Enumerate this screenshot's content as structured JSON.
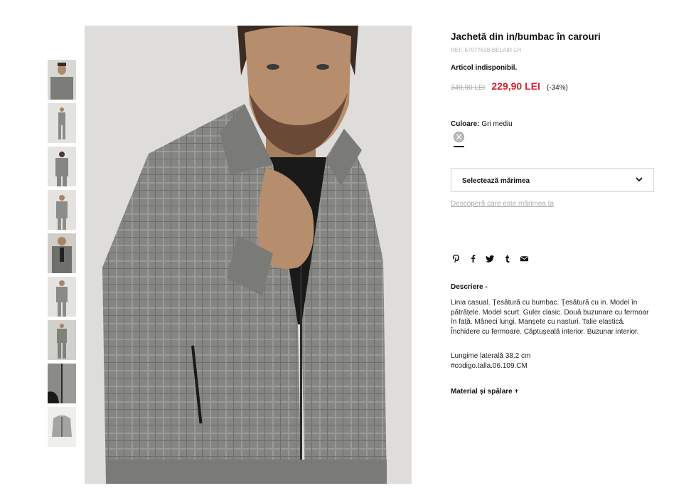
{
  "product": {
    "title": "Jachetă din in/bumbac în carouri",
    "ref": "REF. 67077638-BELAIR-LH",
    "availability": "Articol indisponibil.",
    "old_price": "349,90 LEI",
    "new_price": "229,90 LEI",
    "discount": "(-34%)",
    "color_label": "Culoare:",
    "color_value": "Gri mediu",
    "size_select_label": "Selectează mărimea",
    "size_guide_link": "Descoperă care este mărimea ta",
    "description_title": "Descriere -",
    "description_text": "Linia casual. Țesătură cu bumbac. Țesătură cu in. Model în pătrățele. Model scurt. Guler clasic. Două buzunare cu fermoar în față. Mâneci lungi. Manșete cu nasturi. Talie elastică. Închidere cu fermoare. Căptușeală interior. Buzunar interior.",
    "description_length": "Lungime laterală 38.2 cm",
    "description_code": "#codigo.talla.06.109.CM",
    "material_title": "Material și spălare +"
  },
  "colors": {
    "accent_price": "#d6202e",
    "swatch": "#bdbdbd"
  },
  "share_icons": [
    "pinterest-icon",
    "facebook-icon",
    "twitter-icon",
    "tumblr-icon",
    "email-icon"
  ],
  "thumbnails_count": 9
}
